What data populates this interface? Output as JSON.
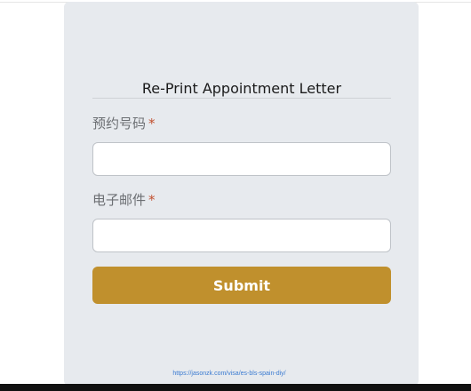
{
  "form": {
    "title": "Re-Print Appointment Letter",
    "appointment_label": "预约号码",
    "email_label": "电子邮件",
    "required_mark": "*",
    "appointment_value": "",
    "email_value": "",
    "submit_label": "Submit"
  },
  "footer": {
    "url_text": "https://jasonzk.com/visa/es-bls-spain-diy/"
  },
  "colors": {
    "card_bg": "#e7eaee",
    "submit_bg": "#c0902d",
    "required": "#c2502f",
    "link": "#3b7bd1"
  }
}
